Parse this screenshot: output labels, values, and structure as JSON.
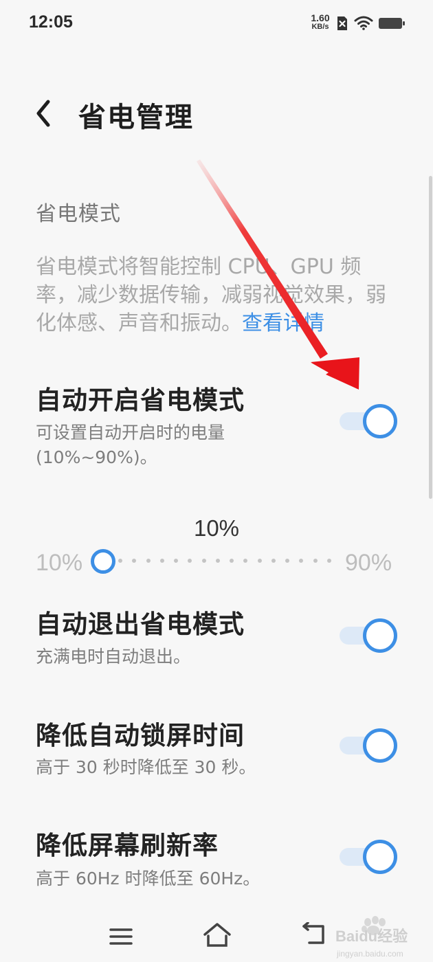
{
  "status_bar": {
    "time": "12:05",
    "net_speed_value": "1.60",
    "net_speed_unit": "KB/s",
    "icons": [
      "sim-disabled-icon",
      "wifi-icon",
      "battery-icon"
    ]
  },
  "header": {
    "back_icon": "chevron-left-icon",
    "title": "省电管理"
  },
  "section": {
    "title": "省电模式",
    "description": "省电模式将智能控制 CPU、GPU 频率，减少数据传输，减弱视觉效果，弱化体感、声音和振动。",
    "details_link": "查看详情"
  },
  "settings": [
    {
      "title": "自动开启省电模式",
      "desc": "可设置自动开启时的电量\n(10%~90%)。",
      "enabled": true
    },
    {
      "title": "自动退出省电模式",
      "desc": "充满电时自动退出。",
      "enabled": true
    },
    {
      "title": "降低自动锁屏时间",
      "desc": "高于 30 秒时降低至 30 秒。",
      "enabled": true
    },
    {
      "title": "降低屏幕刷新率",
      "desc": "高于 60Hz 时降低至 60Hz。",
      "enabled": true
    }
  ],
  "slider": {
    "current_label": "10%",
    "min_label": "10%",
    "max_label": "90%",
    "value_percent": 10,
    "min_percent": 10,
    "max_percent": 90
  },
  "nav_bar": {
    "icons": [
      "menu-icon",
      "home-icon",
      "back-arrow-icon"
    ]
  },
  "watermark": {
    "text": "Baidu经验",
    "subtext": "jingyan.baidu.com"
  },
  "colors": {
    "accent": "#3d8fe5",
    "toggle_track": "#dde9f7",
    "annotation_arrow": "#e8141a"
  }
}
